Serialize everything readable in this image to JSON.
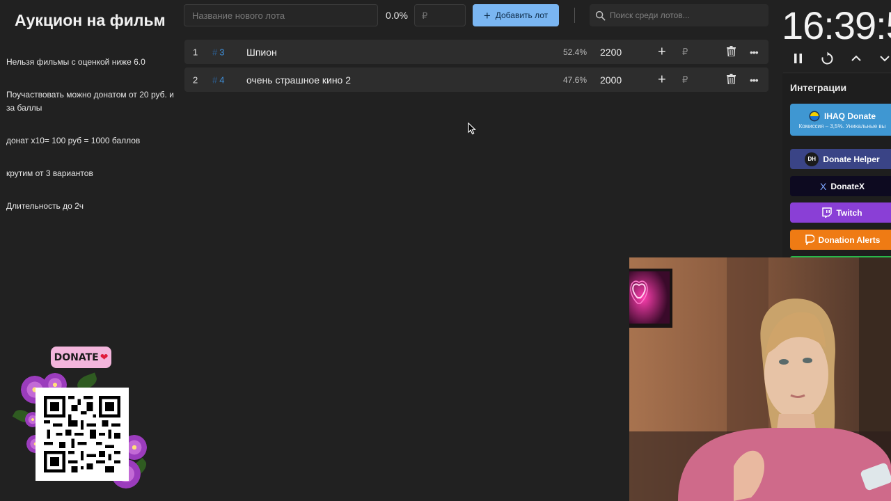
{
  "app": {
    "title": "Аукцион на фильм"
  },
  "rules": [
    "Нельзя фильмы с оценкой ниже 6.0",
    "Поучаствовать можно донатом от 20 руб. и за баллы",
    "донат x10=  100 руб = 1000 баллов",
    "крутим от 3 вариантов",
    "Длительность до 2ч"
  ],
  "toolbar": {
    "lot_name_placeholder": "Название нового лота",
    "percent": "0.0%",
    "amount_placeholder": "₽",
    "add_label": "Добавить лот",
    "search_placeholder": "Поиск среди лотов..."
  },
  "lots": [
    {
      "index": "1",
      "id": "3",
      "name": "Шпион",
      "percent": "52.4%",
      "amount": "2200",
      "currency": "₽"
    },
    {
      "index": "2",
      "id": "4",
      "name": "очень страшное кино 2",
      "percent": "47.6%",
      "amount": "2000",
      "currency": "₽"
    }
  ],
  "timer": {
    "value": "16:39:5"
  },
  "integrations": {
    "title": "Интеграции",
    "items": [
      {
        "label": "IHAQ Donate",
        "sub": "Комиссия – 3,5%. Уникальные вы"
      },
      {
        "label": "Donate Helper",
        "logo": "DH"
      },
      {
        "label": "DonateX",
        "logo": "X"
      },
      {
        "label": "Twitch"
      },
      {
        "label": "Donation Alerts"
      }
    ]
  },
  "donate": {
    "badge": "DONATE",
    "heart": "❤"
  },
  "colors": {
    "background": "#212121",
    "accent_button": "#7ab6f2",
    "lot_id": "#3f8fd8",
    "ihaq": "#3f97d2",
    "donate_helper": "#3a4486",
    "donatex": "#0d0a20",
    "twitch": "#8a3fd6",
    "donation_alerts": "#ef7b14"
  }
}
